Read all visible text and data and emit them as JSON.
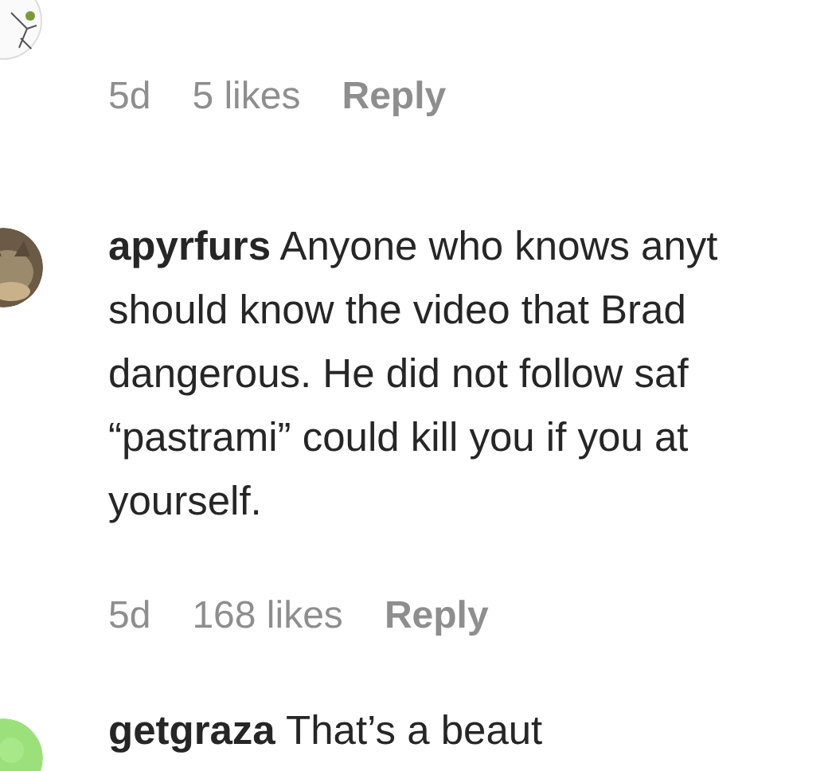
{
  "comments": [
    {
      "meta": {
        "age": "5d",
        "likes": "5 likes",
        "reply": "Reply"
      }
    },
    {
      "username": "apyrfurs",
      "lines": [
        "Anyone who knows anyt",
        "should know the video that Brad",
        "dangerous. He did not follow saf",
        "“pastrami” could kill you if you at",
        "yourself."
      ],
      "meta": {
        "age": "5d",
        "likes": "168 likes",
        "reply": "Reply"
      }
    },
    {
      "username": "getgraza",
      "lines": [
        "That’s a beaut"
      ]
    }
  ]
}
